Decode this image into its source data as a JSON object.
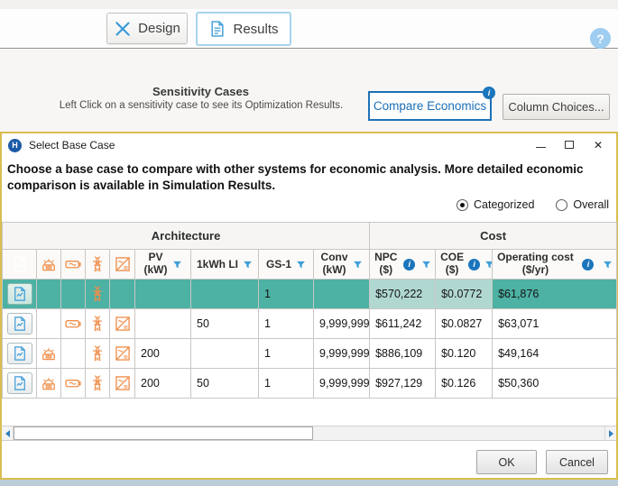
{
  "toolbar": {
    "design_label": "Design",
    "results_label": "Results"
  },
  "icons": {
    "help": "?",
    "info": "i",
    "logo": "H",
    "close": "✕"
  },
  "sensitivity": {
    "title": "Sensitivity Cases",
    "subtitle": "Left Click on a sensitivity case to see its Optimization Results.",
    "compare_economics_label": "Compare Economics",
    "column_choices_label": "Column Choices..."
  },
  "dialog": {
    "title": "Select Base Case",
    "description": "Choose a base case to compare with other systems for economic analysis. More detailed economic comparison is available in Simulation Results.",
    "radio_categorized": "Categorized",
    "radio_overall": "Overall",
    "ok_label": "OK",
    "cancel_label": "Cancel",
    "table": {
      "group_architecture": "Architecture",
      "group_cost": "Cost",
      "col_pv_l1": "PV",
      "col_pv_l2": "(kW)",
      "col_battery": "1kWh LI",
      "col_gs1": "GS-1",
      "col_conv_l1": "Conv",
      "col_conv_l2": "(kW)",
      "col_npc_l1": "NPC",
      "col_npc_l2": "($)",
      "col_coe_l1": "COE",
      "col_coe_l2": "($)",
      "col_opex_l1": "Operating cost",
      "col_opex_l2": "($/yr)",
      "rows": [
        {
          "selected": true,
          "has_pv": false,
          "has_battery": false,
          "has_grid": true,
          "has_converter": false,
          "pv": "",
          "battery": "",
          "gs1": "1",
          "conv": "",
          "npc": "$570,222",
          "coe": "$0.0772",
          "opex": "$61,876"
        },
        {
          "selected": false,
          "has_pv": false,
          "has_battery": true,
          "has_grid": true,
          "has_converter": true,
          "pv": "",
          "battery": "50",
          "gs1": "1",
          "conv": "9,999,999",
          "npc": "$611,242",
          "coe": "$0.0827",
          "opex": "$63,071"
        },
        {
          "selected": false,
          "has_pv": true,
          "has_battery": false,
          "has_grid": true,
          "has_converter": true,
          "pv": "200",
          "battery": "",
          "gs1": "1",
          "conv": "9,999,999",
          "npc": "$886,109",
          "coe": "$0.120",
          "opex": "$49,164"
        },
        {
          "selected": false,
          "has_pv": true,
          "has_battery": true,
          "has_grid": true,
          "has_converter": true,
          "pv": "200",
          "battery": "50",
          "gs1": "1",
          "conv": "9,999,999",
          "npc": "$927,129",
          "coe": "$0.126",
          "opex": "$50,360"
        }
      ]
    }
  },
  "colors": {
    "accent_blue": "#1d70b8",
    "header_blue": "#3ea6da",
    "selection_teal": "#4db1a4",
    "selection_teal_light": "#b0d8d1",
    "icon_orange": "#ef8e49",
    "dialog_border_gold": "#d9bd50",
    "filter_blue": "#3f9fd8",
    "info_blue": "#1b75bc"
  }
}
